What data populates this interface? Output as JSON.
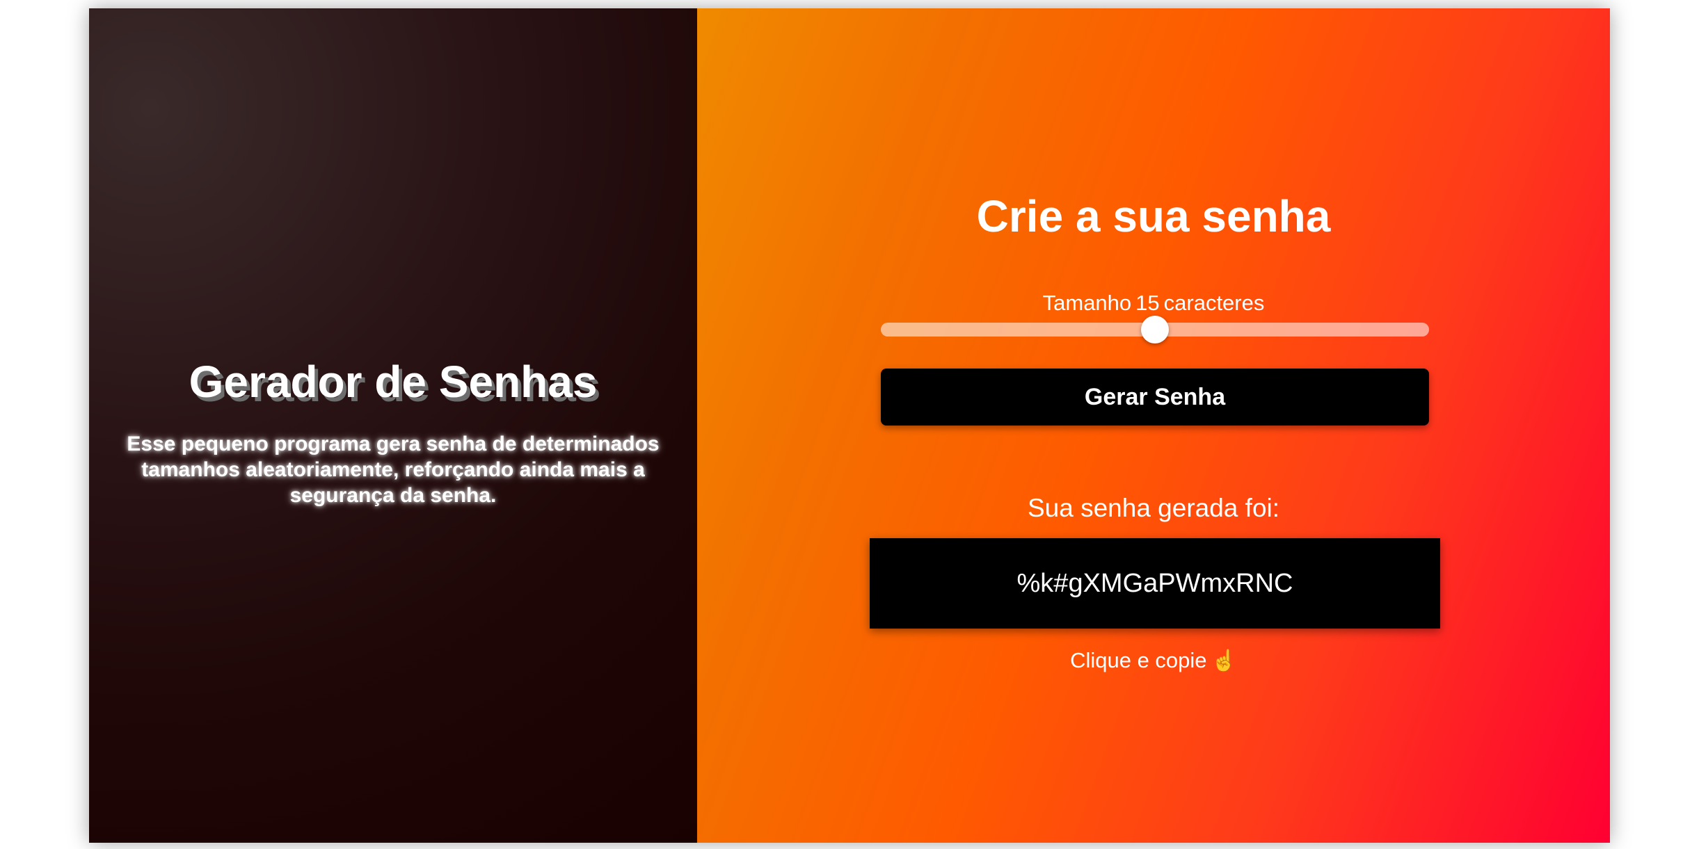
{
  "left_panel": {
    "title": "Gerador de Senhas",
    "description": "Esse pequeno programa gera senha de determinados tamanhos aleatoriamente, reforçando ainda mais a segurança da senha."
  },
  "right_panel": {
    "title": "Crie a sua senha",
    "size_label_prefix": "Tamanho",
    "size_value": "15",
    "size_label_suffix": "caracteres",
    "slider_fraction": 0.5,
    "generate_button_label": "Gerar Senha",
    "result_label": "Sua senha gerada foi:",
    "password": "%k#gXMGaPWmxRNC",
    "copy_hint": "Clique e copie",
    "copy_hint_icon": "pointing-up-hand-icon"
  },
  "colors": {
    "left_bg": "#1f0707",
    "right_gradient_start": "#f08a00",
    "right_gradient_end": "#ff0032",
    "button_bg": "#000000",
    "text": "#ffffff"
  }
}
